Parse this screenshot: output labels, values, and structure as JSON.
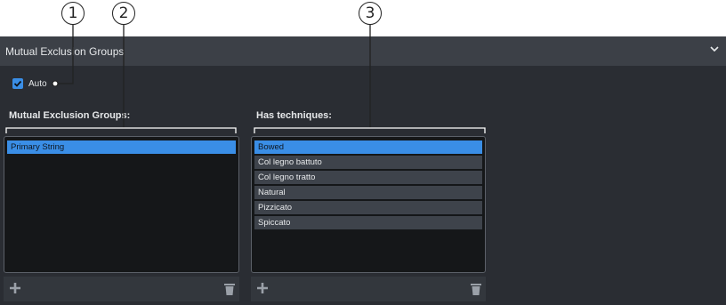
{
  "callouts": [
    "1",
    "2",
    "3"
  ],
  "panel": {
    "title": "Mutual Exclusion Groups",
    "collapse_icon": "chevron-down-icon"
  },
  "auto": {
    "label": "Auto",
    "checked": true
  },
  "groups": {
    "heading": "Mutual Exclusion Groups:",
    "items": [
      {
        "label": "Primary String",
        "selected": true
      }
    ],
    "add_icon": "plus-icon",
    "delete_icon": "trash-icon"
  },
  "techniques": {
    "heading": "Has techniques:",
    "items": [
      {
        "label": "Bowed",
        "selected": true
      },
      {
        "label": "Col legno battuto",
        "selected": false
      },
      {
        "label": "Col legno tratto",
        "selected": false
      },
      {
        "label": "Natural",
        "selected": false
      },
      {
        "label": "Pizzicato",
        "selected": false
      },
      {
        "label": "Spiccato",
        "selected": false
      }
    ],
    "add_icon": "plus-icon",
    "delete_icon": "trash-icon"
  },
  "colors": {
    "accent": "#3a8ee6",
    "panel_bg": "#2a2d33",
    "header_bg": "#3c4047",
    "list_bg": "#151719"
  }
}
